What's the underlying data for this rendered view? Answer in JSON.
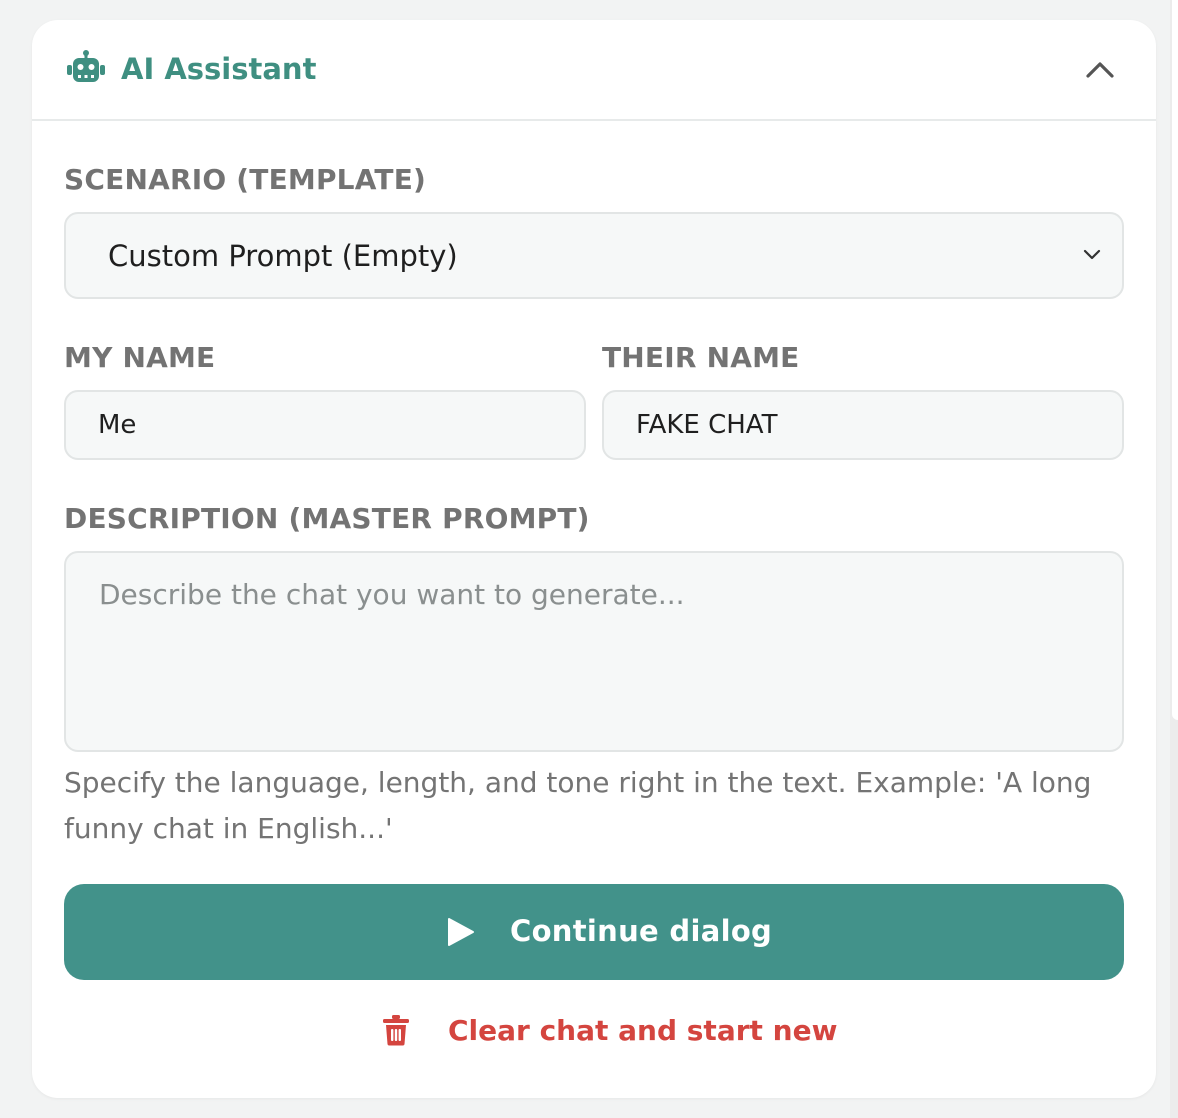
{
  "header": {
    "title": "AI Assistant",
    "icon": "robot-icon",
    "collapse_icon": "chevron-up-icon"
  },
  "scenario": {
    "label": "SCENARIO (TEMPLATE)",
    "selected": "Custom Prompt (Empty)"
  },
  "names": {
    "my_label": "MY NAME",
    "my_value": "Me",
    "their_label": "THEIR NAME",
    "their_value": "FAKE CHAT"
  },
  "description": {
    "label": "DESCRIPTION (MASTER PROMPT)",
    "placeholder": "Describe the chat you want to generate...",
    "value": "",
    "hint": "Specify the language, length, and tone right in the text. Example: 'A long funny chat in English...'"
  },
  "actions": {
    "continue_label": "Continue dialog",
    "continue_icon": "play-icon",
    "clear_label": "Clear chat and start new",
    "clear_icon": "trash-icon"
  },
  "colors": {
    "accent": "#42928a",
    "title": "#3f8f81",
    "danger": "#d4453f",
    "label": "#737373",
    "field_bg": "#f6f8f8"
  }
}
